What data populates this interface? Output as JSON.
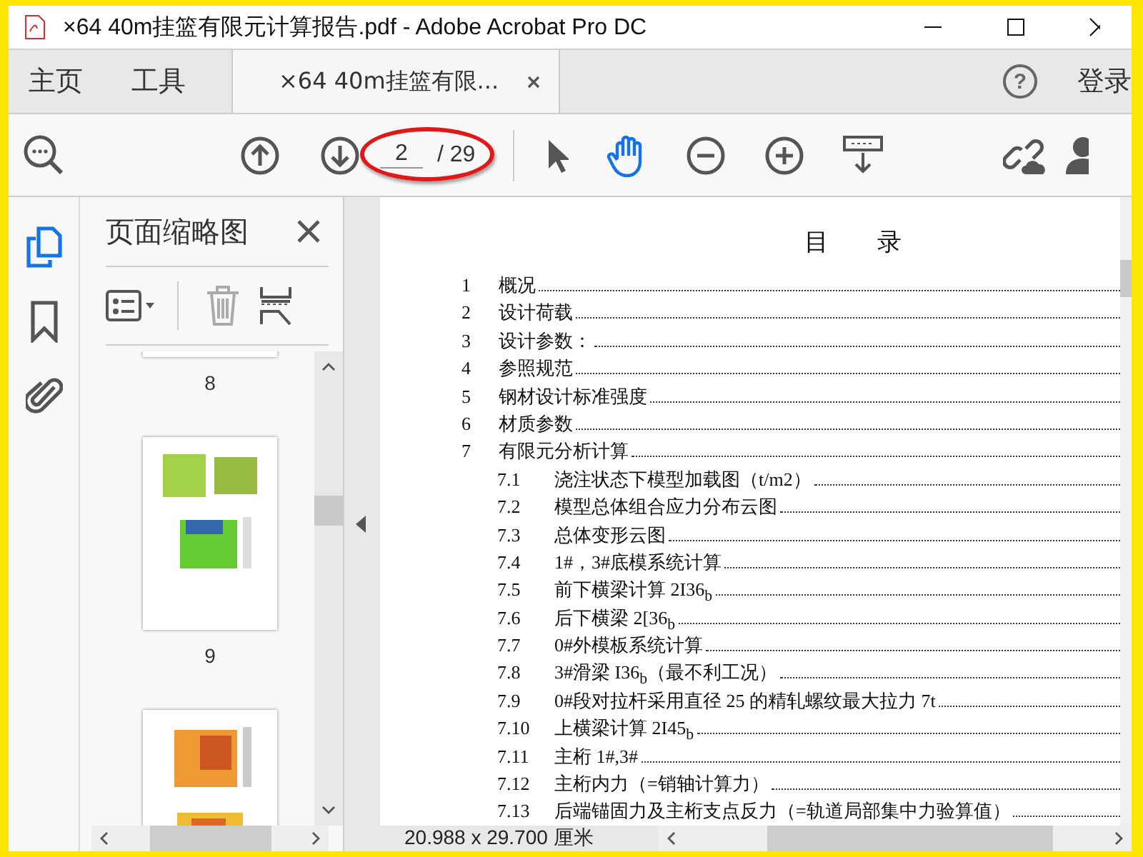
{
  "window": {
    "title": "×64 40m挂篮有限元计算报告.pdf - Adobe Acrobat Pro DC"
  },
  "tabs": [
    {
      "label": "主页",
      "selected": false,
      "kind": "nav"
    },
    {
      "label": "工具",
      "selected": false,
      "kind": "nav"
    },
    {
      "label": "×64 40m挂篮有限...",
      "selected": true,
      "kind": "document"
    }
  ],
  "help": {
    "label": "?"
  },
  "account": {
    "label": "登录"
  },
  "page_nav": {
    "current": "2",
    "total": "/ 29"
  },
  "tools": [
    {
      "kind": "select",
      "selected": false
    },
    {
      "kind": "hand",
      "selected": true
    }
  ],
  "rail": [
    {
      "kind": "pages",
      "selected": true
    },
    {
      "kind": "bookmarks",
      "selected": false
    },
    {
      "kind": "attachments",
      "selected": false
    }
  ],
  "thumbnail_panel": {
    "title": "页面缩略图",
    "thumbnails": [
      {
        "kind": "bottom",
        "label": "8"
      },
      {
        "kind": "full",
        "label": "9"
      },
      {
        "kind": "top"
      }
    ]
  },
  "document": {
    "heading": "目　　录",
    "toc": [
      {
        "number": "1",
        "text": "概况"
      },
      {
        "number": "2",
        "text": "设计荷载"
      },
      {
        "number": "3",
        "text": "设计参数："
      },
      {
        "number": "4",
        "text": "参照规范"
      },
      {
        "number": "5",
        "text": "钢材设计标准强度"
      },
      {
        "number": "6",
        "text": "材质参数"
      },
      {
        "number": "7",
        "text": "有限元分析计算",
        "children": [
          {
            "number": "7.1",
            "text": "浇注状态下模型加载图（t/m2）"
          },
          {
            "number": "7.2",
            "text": "模型总体组合应力分布云图"
          },
          {
            "number": "7.3",
            "text": "总体变形云图"
          },
          {
            "number": "7.4",
            "text": "1#，3#底模系统计算"
          },
          {
            "number": "7.5",
            "text": "前下横梁计算 2I36$_{b}$"
          },
          {
            "number": "7.6",
            "text": "后下横梁 2[36$_{b}$"
          },
          {
            "number": "7.7",
            "text": "0#外模板系统计算"
          },
          {
            "number": "7.8",
            "text": "3#滑梁 I36$_{b}$（最不利工况）"
          },
          {
            "number": "7.9",
            "text": "0#段对拉杆采用直径 25 的精轧螺纹最大拉力 7t"
          },
          {
            "number": "7.10",
            "text": "上横梁计算 2I45$_{b}$"
          },
          {
            "number": "7.11",
            "text": "主桁 1#,3#"
          },
          {
            "number": "7.12",
            "text": "主桁内力（=销轴计算力）"
          },
          {
            "number": "7.13",
            "text": "后端锚固力及主桁支点反力（=轨道局部集中力验算值）"
          }
        ]
      }
    ]
  },
  "status_bar": {
    "page_size": "20.988 x 29.700 厘米"
  }
}
